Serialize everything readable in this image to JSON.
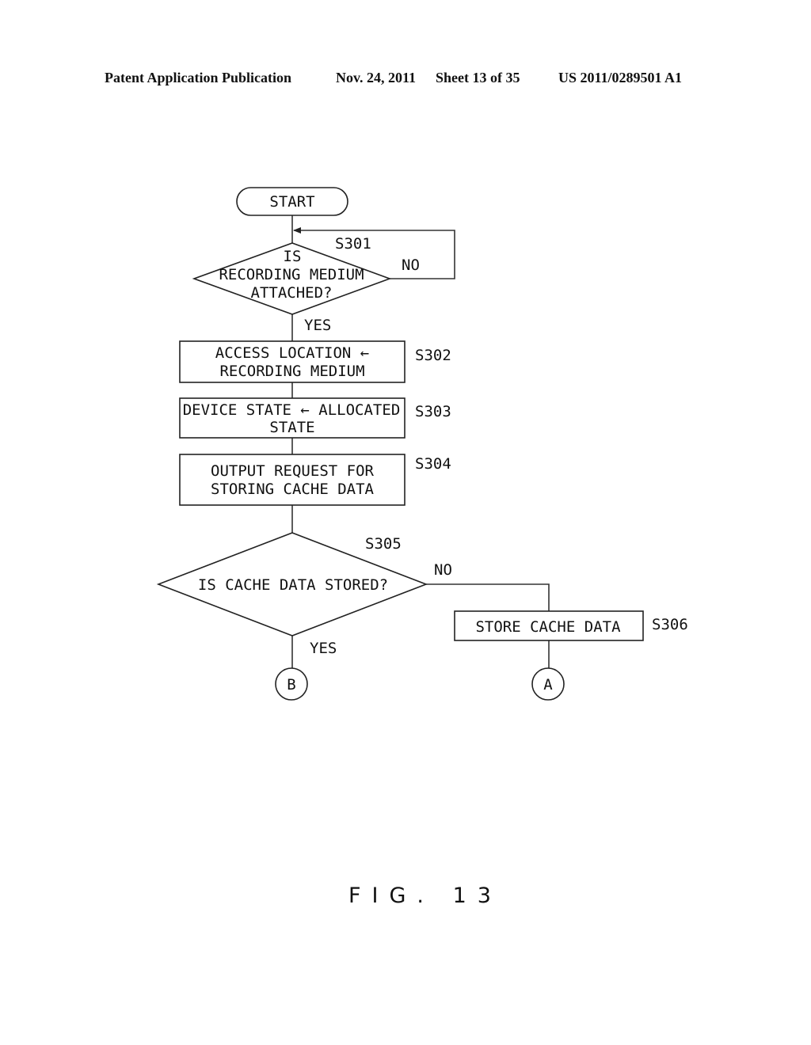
{
  "header": {
    "publication": "Patent Application Publication",
    "date": "Nov. 24, 2011",
    "sheet": "Sheet 13 of 35",
    "number": "US 2011/0289501 A1"
  },
  "flowchart": {
    "start": "START",
    "s301": {
      "id": "S301",
      "lines": [
        "IS",
        "RECORDING MEDIUM",
        "ATTACHED?"
      ],
      "no": "NO",
      "yes": "YES"
    },
    "s302": {
      "id": "S302",
      "lines": [
        "ACCESS LOCATION ←",
        "RECORDING MEDIUM"
      ]
    },
    "s303": {
      "id": "S303",
      "lines": [
        "DEVICE STATE ← ALLOCATED",
        "STATE"
      ]
    },
    "s304": {
      "id": "S304",
      "lines": [
        "OUTPUT REQUEST FOR",
        "STORING CACHE DATA"
      ]
    },
    "s305": {
      "id": "S305",
      "lines": [
        "IS CACHE DATA STORED?"
      ],
      "no": "NO",
      "yes": "YES"
    },
    "s306": {
      "id": "S306",
      "lines": [
        "STORE CACHE DATA"
      ]
    },
    "connector_b": "B",
    "connector_a": "A"
  },
  "figure_label": "FIG. 13"
}
